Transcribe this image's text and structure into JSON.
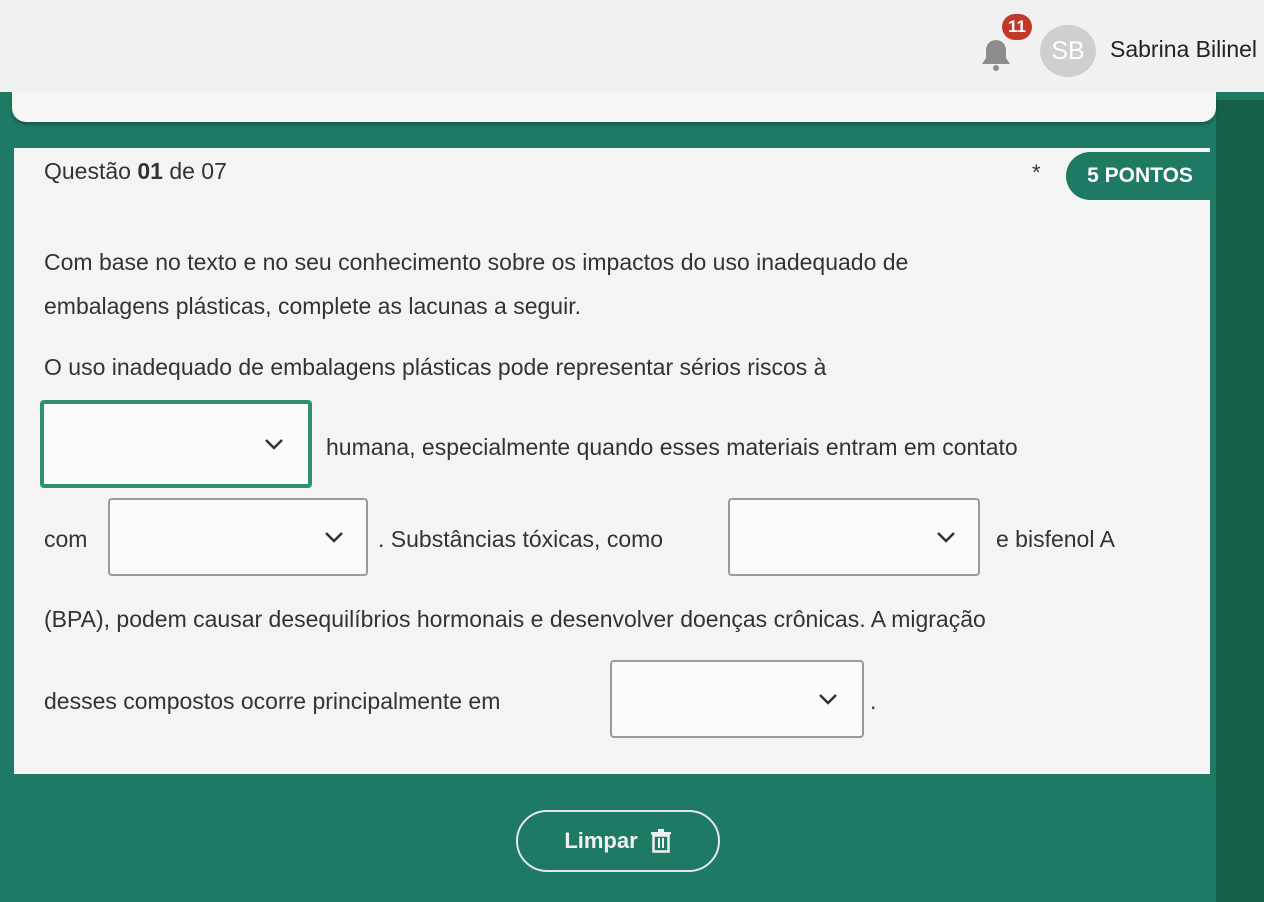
{
  "header": {
    "notification_count": "11",
    "avatar_initials": "SB",
    "user_name": "Sabrina Bilinel"
  },
  "question": {
    "label_prefix": "Questão ",
    "number": "01",
    "label_suffix": " de 07",
    "required_mark": "*",
    "points": "5 PONTOS",
    "intro_line1": "Com base no texto e no seu conhecimento sobre os impactos do uso inadequado de",
    "intro_line2": "embalagens plásticas, complete as lacunas a seguir.",
    "text_1": "O uso inadequado de embalagens plásticas pode representar sérios riscos à",
    "text_2": "humana, especialmente quando esses materiais entram em contato",
    "text_3": "com",
    "text_4": ". Substâncias tóxicas, como",
    "text_5": "e bisfenol A",
    "text_6": "(BPA), podem causar desequilíbrios hormonais e desenvolver doenças crônicas. A migração",
    "text_7": "desses compostos ocorre principalmente em",
    "text_8": ".",
    "blanks": [
      "",
      "",
      "",
      ""
    ]
  },
  "footer": {
    "clear_label": "Limpar"
  },
  "colors": {
    "accent": "#1f7a63",
    "badge": "#c0392b"
  }
}
